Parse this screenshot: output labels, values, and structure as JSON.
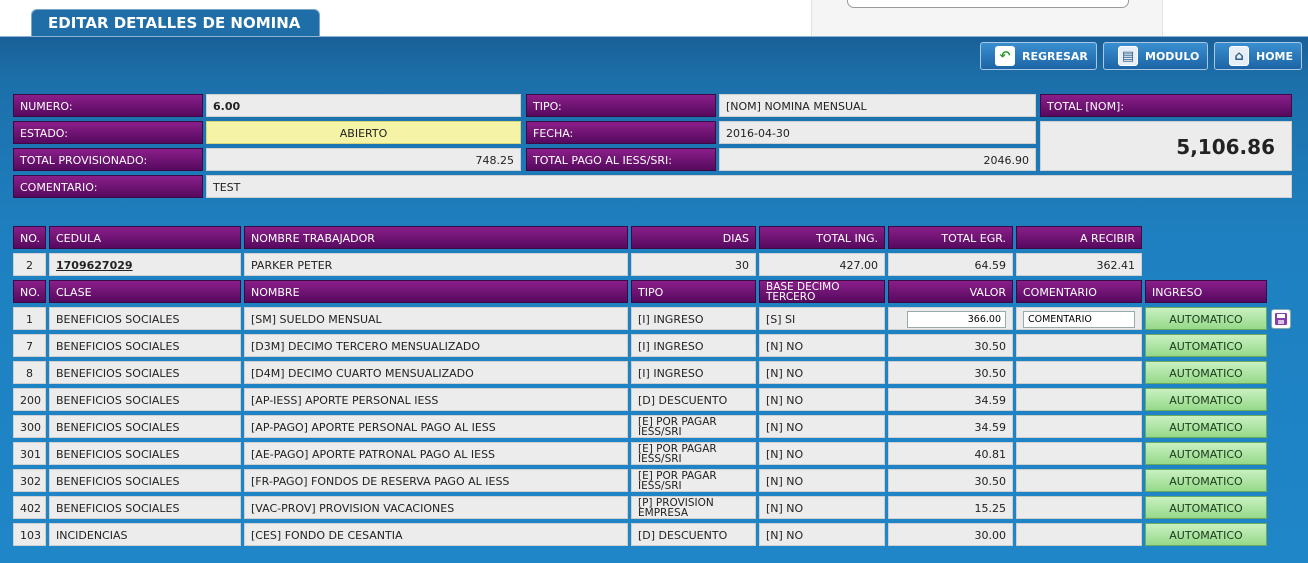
{
  "tab_title": "EDITAR DETALLES DE NOMINA",
  "nav": {
    "regresar": "REGRESAR",
    "modulo": "MODULO",
    "home": "HOME"
  },
  "header": {
    "numero_label": "NUMERO:",
    "numero": "6.00",
    "tipo_label": "TIPO:",
    "tipo": "[NOM] NOMINA MENSUAL",
    "total_label": "TOTAL [NOM]:",
    "total": "5,106.86",
    "estado_label": "ESTADO:",
    "estado": "ABIERTO",
    "fecha_label": "FECHA:",
    "fecha": "2016-04-30",
    "provisionado_label": "TOTAL PROVISIONADO:",
    "provisionado": "748.25",
    "pago_iess_label": "TOTAL PAGO AL IESS/SRI:",
    "pago_iess": "2046.90",
    "comentario_label": "COMENTARIO:",
    "comentario": "TEST"
  },
  "worker_cols": [
    "NO.",
    "CEDULA",
    "NOMBRE TRABAJADOR",
    "DIAS",
    "TOTAL ING.",
    "TOTAL EGR.",
    "A RECIBIR"
  ],
  "worker": {
    "no": "2",
    "cedula": "1709627029",
    "nombre": "PARKER PETER",
    "dias": "30",
    "total_ing": "427.00",
    "total_egr": "64.59",
    "a_recibir": "362.41"
  },
  "detail_cols": [
    "NO.",
    "CLASE",
    "NOMBRE",
    "TIPO",
    "BASE DECIMO TERCERO",
    "VALOR",
    "COMENTARIO",
    "INGRESO"
  ],
  "edit_row": {
    "valor": "366.00",
    "comentario": "COMENTARIO"
  },
  "rows": [
    {
      "no": "1",
      "clase": "BENEFICIOS SOCIALES",
      "nombre": "[SM] SUELDO MENSUAL",
      "tipo": "[I] INGRESO",
      "base": "[S] SI",
      "valor": "",
      "ingreso": "AUTOMATICO"
    },
    {
      "no": "7",
      "clase": "BENEFICIOS SOCIALES",
      "nombre": "[D3M] DECIMO TERCERO MENSUALIZADO",
      "tipo": "[I] INGRESO",
      "base": "[N] NO",
      "valor": "30.50",
      "ingreso": "AUTOMATICO"
    },
    {
      "no": "8",
      "clase": "BENEFICIOS SOCIALES",
      "nombre": "[D4M] DECIMO CUARTO MENSUALIZADO",
      "tipo": "[I] INGRESO",
      "base": "[N] NO",
      "valor": "30.50",
      "ingreso": "AUTOMATICO"
    },
    {
      "no": "200",
      "clase": "BENEFICIOS SOCIALES",
      "nombre": "[AP-IESS] APORTE PERSONAL IESS",
      "tipo": "[D] DESCUENTO",
      "base": "[N] NO",
      "valor": "34.59",
      "ingreso": "AUTOMATICO"
    },
    {
      "no": "300",
      "clase": "BENEFICIOS SOCIALES",
      "nombre": "[AP-PAGO] APORTE PERSONAL PAGO AL IESS",
      "tipo": "[E] POR PAGAR IESS/SRI",
      "base": "[N] NO",
      "valor": "34.59",
      "ingreso": "AUTOMATICO"
    },
    {
      "no": "301",
      "clase": "BENEFICIOS SOCIALES",
      "nombre": "[AE-PAGO] APORTE PATRONAL PAGO AL IESS",
      "tipo": "[E] POR PAGAR IESS/SRI",
      "base": "[N] NO",
      "valor": "40.81",
      "ingreso": "AUTOMATICO"
    },
    {
      "no": "302",
      "clase": "BENEFICIOS SOCIALES",
      "nombre": "[FR-PAGO] FONDOS DE RESERVA PAGO AL IESS",
      "tipo": "[E] POR PAGAR IESS/SRI",
      "base": "[N] NO",
      "valor": "30.50",
      "ingreso": "AUTOMATICO"
    },
    {
      "no": "402",
      "clase": "BENEFICIOS SOCIALES",
      "nombre": "[VAC-PROV] PROVISION VACACIONES",
      "tipo": "[P] PROVISION EMPRESA",
      "base": "[N] NO",
      "valor": "15.25",
      "ingreso": "AUTOMATICO"
    },
    {
      "no": "103",
      "clase": "INCIDENCIAS",
      "nombre": "[CES] FONDO DE CESANTIA",
      "tipo": "[D] DESCUENTO",
      "base": "[N] NO",
      "valor": "30.00",
      "ingreso": "AUTOMATICO"
    }
  ]
}
